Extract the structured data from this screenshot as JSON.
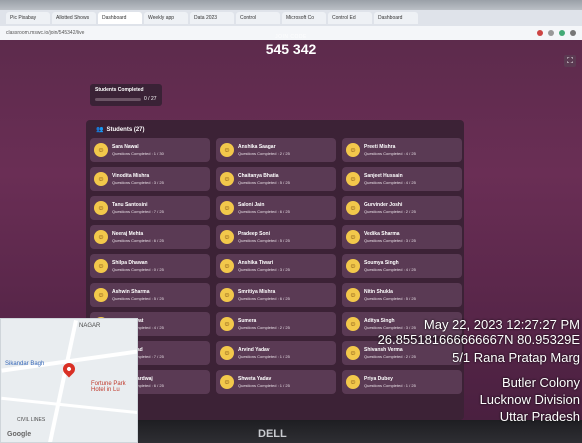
{
  "browser": {
    "tabs": [
      "Pic Pixabay",
      "Allotted Shows",
      "Dashboard",
      "Weekly app",
      "Data 2023",
      "Control",
      "Microsoft Co",
      "Control Ed",
      "Dashboard"
    ],
    "url": "classroom.mswc.io/join/545342/live"
  },
  "header": {
    "join_label": "JOIN CODE",
    "join_code": "545 342"
  },
  "progress": {
    "label": "Students Completed",
    "value_text": "0 / 27",
    "fraction": 0.0
  },
  "students": {
    "title": "Students (27)",
    "list": [
      {
        "name": "Sara Nawal",
        "status": "Questions Completed : 1 / 30"
      },
      {
        "name": "Anshika Saagar",
        "status": "Questions Completed : 2 / 25"
      },
      {
        "name": "Preeti Mishra",
        "status": "Questions Completed : 4 / 25"
      },
      {
        "name": "Vinodita Mishra",
        "status": "Questions Completed : 3 / 25"
      },
      {
        "name": "Chaitanya Bhatia",
        "status": "Questions Completed : 5 / 25"
      },
      {
        "name": "Sanjeet Hussain",
        "status": "Questions Completed : 4 / 25"
      },
      {
        "name": "Tanu Santosini",
        "status": "Questions Completed : 7 / 25"
      },
      {
        "name": "Saloni Jain",
        "status": "Questions Completed : 6 / 25"
      },
      {
        "name": "Gurvinder Joshi",
        "status": "Questions Completed : 2 / 25"
      },
      {
        "name": "Neeraj Mehta",
        "status": "Questions Completed : 6 / 25"
      },
      {
        "name": "Pradeep Soni",
        "status": "Questions Completed : 5 / 25"
      },
      {
        "name": "Vedika Sharma",
        "status": "Questions Completed : 3 / 25"
      },
      {
        "name": "Shilpa Dhawan",
        "status": "Questions Completed : 0 / 25"
      },
      {
        "name": "Anshika Tiwari",
        "status": "Questions Completed : 3 / 25"
      },
      {
        "name": "Soumya Singh",
        "status": "Questions Completed : 4 / 25"
      },
      {
        "name": "Ashwin Sharma",
        "status": "Questions Completed : 5 / 25"
      },
      {
        "name": "Smritiya Mishra",
        "status": "Questions Completed : 6 / 25"
      },
      {
        "name": "Nitin Shukla",
        "status": "Questions Completed : 5 / 25"
      },
      {
        "name": "Aditya Rawat",
        "status": "Questions Completed : 4 / 25"
      },
      {
        "name": "Sumera",
        "status": "Questions Completed : 2 / 25"
      },
      {
        "name": "Aditya Singh",
        "status": "Questions Completed : 3 / 25"
      },
      {
        "name": "Ankit Ahmad",
        "status": "Questions Completed : 7 / 25"
      },
      {
        "name": "Arvind Yadav",
        "status": "Questions Completed : 1 / 25"
      },
      {
        "name": "Shivansh Verma",
        "status": "Questions Completed : 2 / 25"
      },
      {
        "name": "Vikrant Bhardwaj",
        "status": "Questions Completed : 6 / 25"
      },
      {
        "name": "Shweta Yadav",
        "status": "Questions Completed : 1 / 25"
      },
      {
        "name": "Priya Dubey",
        "status": "Questions Completed : 1 / 25"
      }
    ]
  },
  "map": {
    "labels": [
      "NAGAR",
      "Sikandar Bagh",
      "Fortune Park Hotel in Lu",
      "CIVIL LINES"
    ],
    "logo": "Google"
  },
  "overlay": {
    "datetime": "May 22, 2023 12:27:27 PM",
    "coords": "26.855181666666667N 80.95329E",
    "address_line1": "5/1 Rana Pratap Marg",
    "address_line2": "Butler Colony",
    "address_line3": "Lucknow Division",
    "address_line4": "Uttar Pradesh"
  },
  "laptop": {
    "brand": "DELL"
  },
  "colors": {
    "background": "#6a2e55",
    "card": "#5a3a54",
    "avatar": "#f2c84b"
  }
}
